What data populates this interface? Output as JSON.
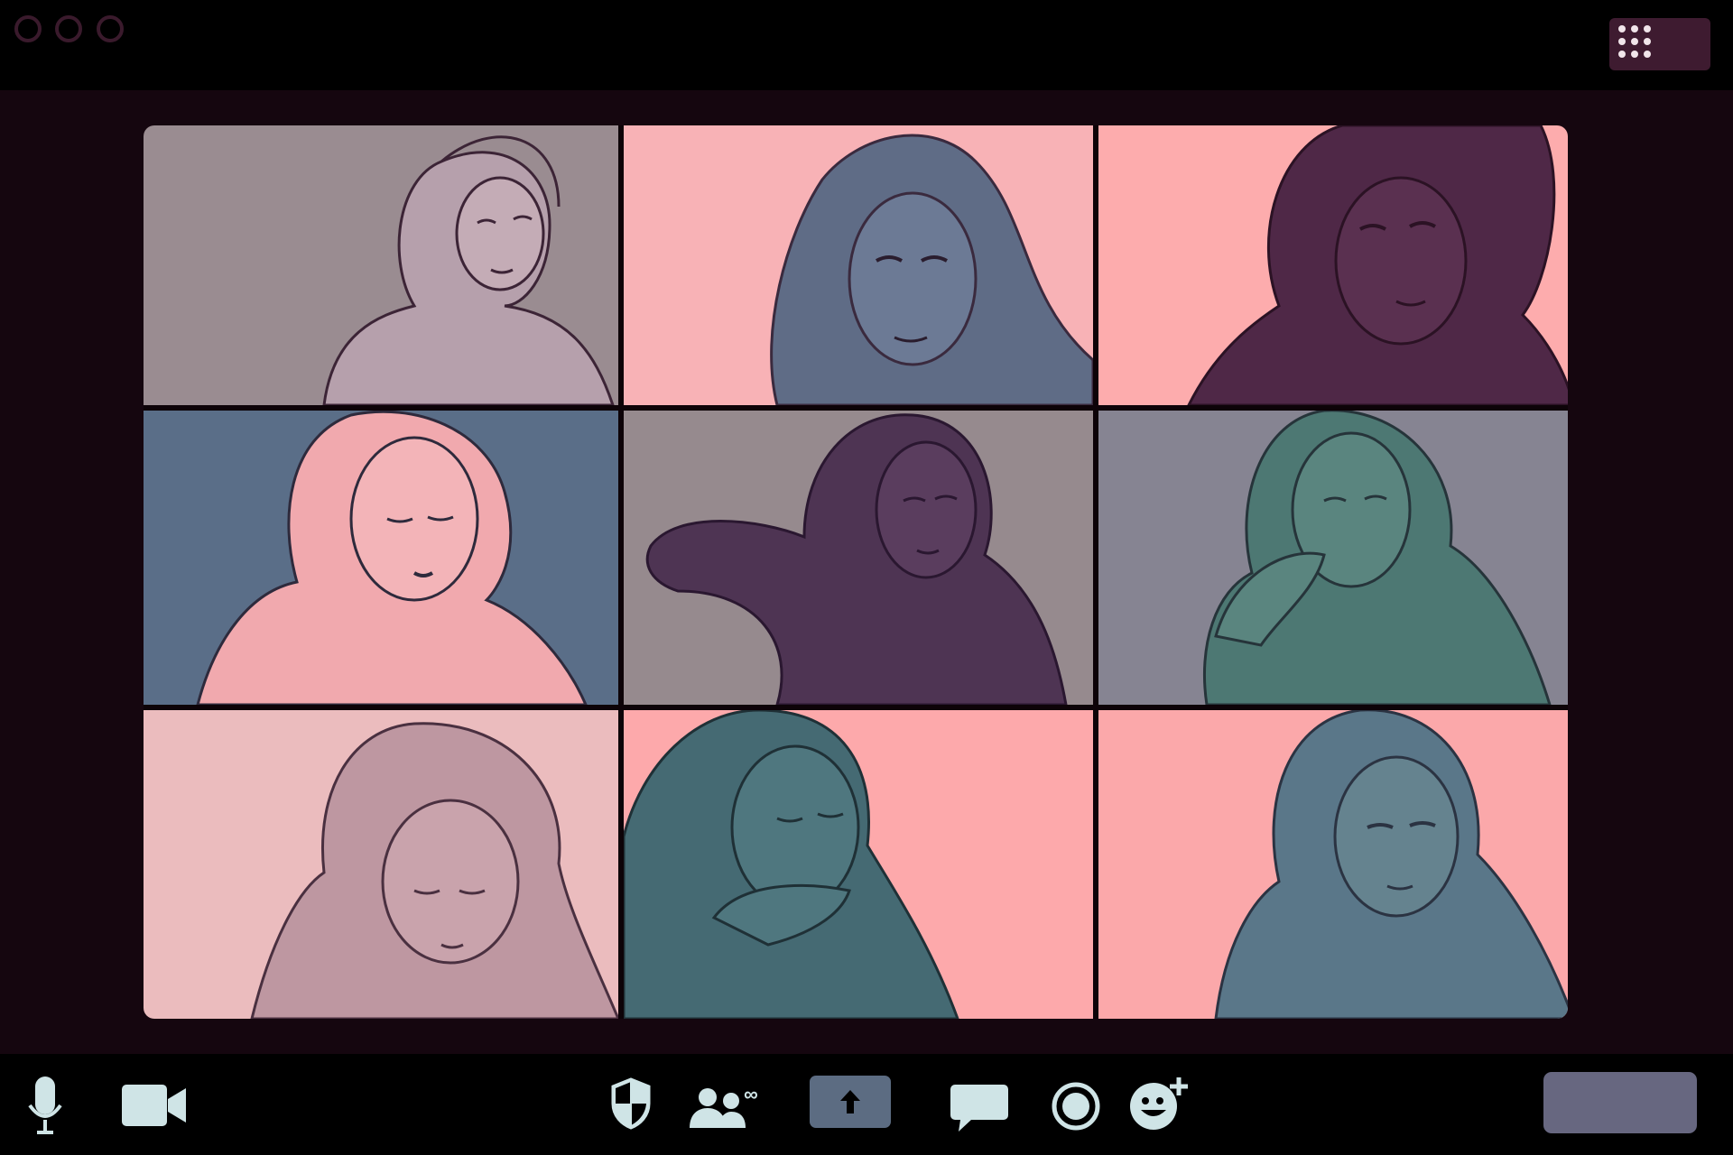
{
  "window": {
    "controls": [
      "window-dot-1",
      "window-dot-2",
      "window-dot-3"
    ],
    "grid_view_icon": "grid-dots-icon"
  },
  "participants": [
    {
      "tile": 1,
      "background": "#9a8c91",
      "figure_color": "#b6a0ac"
    },
    {
      "tile": 2,
      "background": "#f8b2b6",
      "figure_color": "#5f6c86"
    },
    {
      "tile": 3,
      "background": "#fdacad",
      "figure_color": "#4f2847"
    },
    {
      "tile": 4,
      "background": "#5a6e88",
      "figure_color": "#f1a9ae"
    },
    {
      "tile": 5,
      "background": "#968a8e",
      "figure_color": "#4e3453"
    },
    {
      "tile": 6,
      "background": "#868492",
      "figure_color": "#4d7873"
    },
    {
      "tile": 7,
      "background": "#ebbcbe",
      "figure_color": "#be97a1"
    },
    {
      "tile": 8,
      "background": "#fda9ab",
      "figure_color": "#456a73"
    },
    {
      "tile": 9,
      "background": "#fba8aa",
      "figure_color": "#5a7789"
    }
  ],
  "toolbar": {
    "left": [
      "microphone-icon",
      "camera-icon"
    ],
    "center": [
      "security-shield-icon",
      "participants-icon",
      "share-screen-icon",
      "chat-icon",
      "record-icon",
      "reactions-icon"
    ],
    "right": [
      "end-button"
    ],
    "icon_color": "#cfe4e6",
    "share_color": "#5c6c82",
    "end_color": "#676780"
  }
}
